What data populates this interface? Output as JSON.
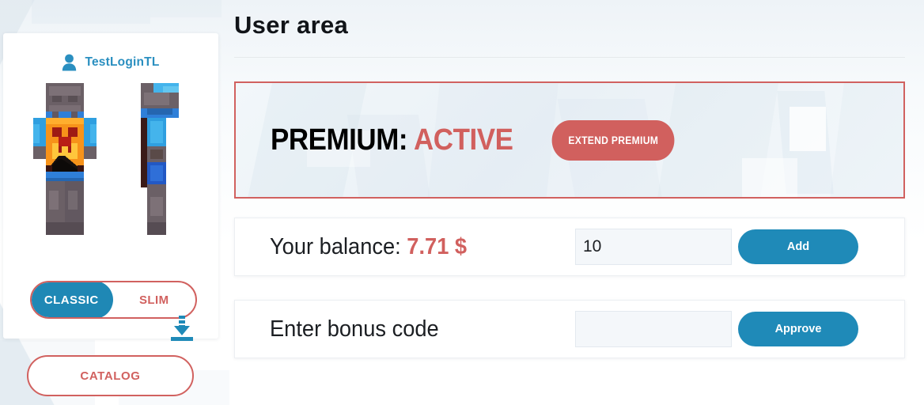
{
  "sidebar": {
    "user": {
      "icon": "user-icon",
      "name": "TestLoginTL"
    },
    "skin": {
      "download_icon": "download-icon"
    },
    "model_toggle": {
      "classic_label": "CLASSIC",
      "slim_label": "SLIM",
      "selected": "CLASSIC"
    },
    "catalog_label": "CATALOG"
  },
  "main": {
    "title": "User area",
    "premium": {
      "label": "PREMIUM:",
      "status": "ACTIVE",
      "extend_label": "EXTEND PREMIUM"
    },
    "balance_row": {
      "label_prefix": "Your balance:",
      "amount": "7.71 $",
      "input_value": "10",
      "button_label": "Add"
    },
    "bonus_row": {
      "label": "Enter bonus code",
      "input_value": "",
      "button_label": "Approve"
    }
  },
  "colors": {
    "accent_blue": "#1f8ab8",
    "accent_red": "#d1605e",
    "title_black": "#111418"
  }
}
